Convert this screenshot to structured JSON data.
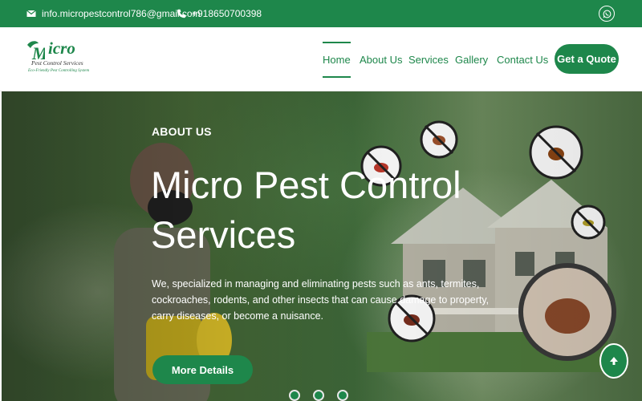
{
  "topbar": {
    "email": "info.micropestcontrol786@gmail.com",
    "phone": "+918650700398",
    "email_icon": "envelope-icon",
    "phone_icon": "phone-icon",
    "social_icon": "whatsapp-icon"
  },
  "logo": {
    "brand": "icro",
    "subtitle": "Pest Control Services",
    "tagline": "Eco-Friendly Pest Controlling System"
  },
  "nav": {
    "items": [
      {
        "label": "Home",
        "active": true
      },
      {
        "label": "About Us"
      },
      {
        "label": "Services"
      },
      {
        "label": "Gallery"
      },
      {
        "label": "Contact Us"
      }
    ],
    "cta": "Get a Quote"
  },
  "hero": {
    "eyebrow": "ABOUT US",
    "title": "Micro Pest Control Services",
    "description": "We, specialized in managing and eliminating pests such as ants, termites, cockroaches, rodents, and other insects that can cause damage to property, carry diseases, or become a nuisance.",
    "button": "More Details",
    "slide_count": 3
  },
  "scroll_top_icon": "arrow-up-icon",
  "colors": {
    "brand_green": "#1e874b"
  }
}
